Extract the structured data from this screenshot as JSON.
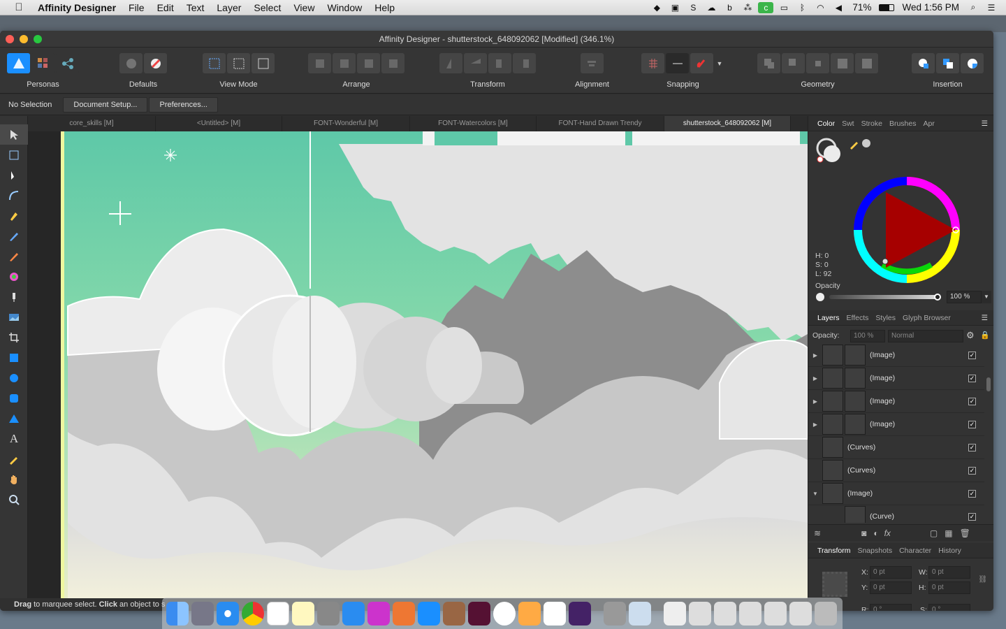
{
  "menubar": {
    "app": "Affinity Designer",
    "items": [
      "File",
      "Edit",
      "Text",
      "Layer",
      "Select",
      "View",
      "Window",
      "Help"
    ],
    "battery": "71%",
    "clock": "Wed 1:56 PM"
  },
  "window": {
    "title": "Affinity Designer - shutterstock_648092062 [Modified] (346.1%)"
  },
  "toolbar": {
    "personas": "Personas",
    "defaults": "Defaults",
    "view_mode": "View Mode",
    "arrange": "Arrange",
    "transform": "Transform",
    "alignment": "Alignment",
    "snapping": "Snapping",
    "geometry": "Geometry",
    "insertion": "Insertion"
  },
  "context": {
    "selection": "No Selection",
    "document_setup": "Document Setup...",
    "preferences": "Preferences..."
  },
  "doc_tabs": [
    "core_skills [M]",
    "<Untitled> [M]",
    "FONT-Wonderful [M]",
    "FONT-Watercolors [M]",
    "FONT-Hand Drawn Trendy",
    "shutterstock_648092062 [M]"
  ],
  "color_panel": {
    "tabs": [
      "Color",
      "Swt",
      "Stroke",
      "Brushes",
      "Apr"
    ],
    "h": "H: 0",
    "s": "S: 0",
    "l": "L: 92",
    "opacity_label": "Opacity",
    "opacity_value": "100 %"
  },
  "layers_panel": {
    "tabs": [
      "Layers",
      "Effects",
      "Styles",
      "Glyph Browser"
    ],
    "opacity_label": "Opacity:",
    "opacity_value": "100 %",
    "blend": "Normal",
    "rows": [
      {
        "name": "(Image)",
        "expand": "▶"
      },
      {
        "name": "(Image)",
        "expand": "▶"
      },
      {
        "name": "(Image)",
        "expand": "▶"
      },
      {
        "name": "(Image)",
        "expand": "▶"
      },
      {
        "name": "(Curves)",
        "expand": ""
      },
      {
        "name": "(Curves)",
        "expand": ""
      },
      {
        "name": "(Image)",
        "expand": "▼"
      },
      {
        "name": "(Curve)",
        "expand": ""
      }
    ]
  },
  "transform_panel": {
    "tabs": [
      "Transform",
      "Snapshots",
      "Character",
      "History"
    ],
    "x_label": "X:",
    "x": "0 pt",
    "y_label": "Y:",
    "y": "0 pt",
    "w_label": "W:",
    "w": "0 pt",
    "h_label": "H:",
    "h": "0 pt",
    "r_label": "R:",
    "r": "0 °",
    "s_label": "S:",
    "s": "0 °"
  },
  "status": {
    "drag": "Drag",
    "text1": " to marquee select. ",
    "click": "Click",
    "text2": " an object to s"
  },
  "colors": {
    "accent": "#1a8fff",
    "teal": "#5ec8a8",
    "cloud": "#e6e6e6"
  }
}
